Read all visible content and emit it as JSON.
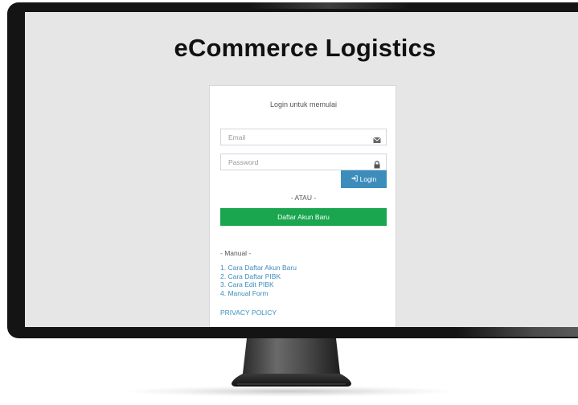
{
  "app": {
    "title": "eCommerce Logistics"
  },
  "login": {
    "heading": "Login untuk memulai",
    "email_placeholder": "Email",
    "password_placeholder": "Password",
    "login_button": "Login",
    "or_text": "- ATAU -",
    "register_button": "Daftar Akun Baru"
  },
  "manual": {
    "heading": "- Manual -",
    "links": [
      "1. Cara Daftar Akun Baru",
      "2. Cara Daftar PIBK",
      "3. Cara Edit PIBK",
      "4. Manual Form"
    ]
  },
  "footer": {
    "privacy_link": "PRIVACY POLICY"
  },
  "icons": {
    "email": "envelope-icon",
    "password": "lock-icon",
    "login": "sign-in-icon"
  },
  "colors": {
    "screen_bg": "#e6e6e6",
    "login_button": "#3c8dbc",
    "register_button": "#1aa54f",
    "link": "#3c8dbc"
  }
}
